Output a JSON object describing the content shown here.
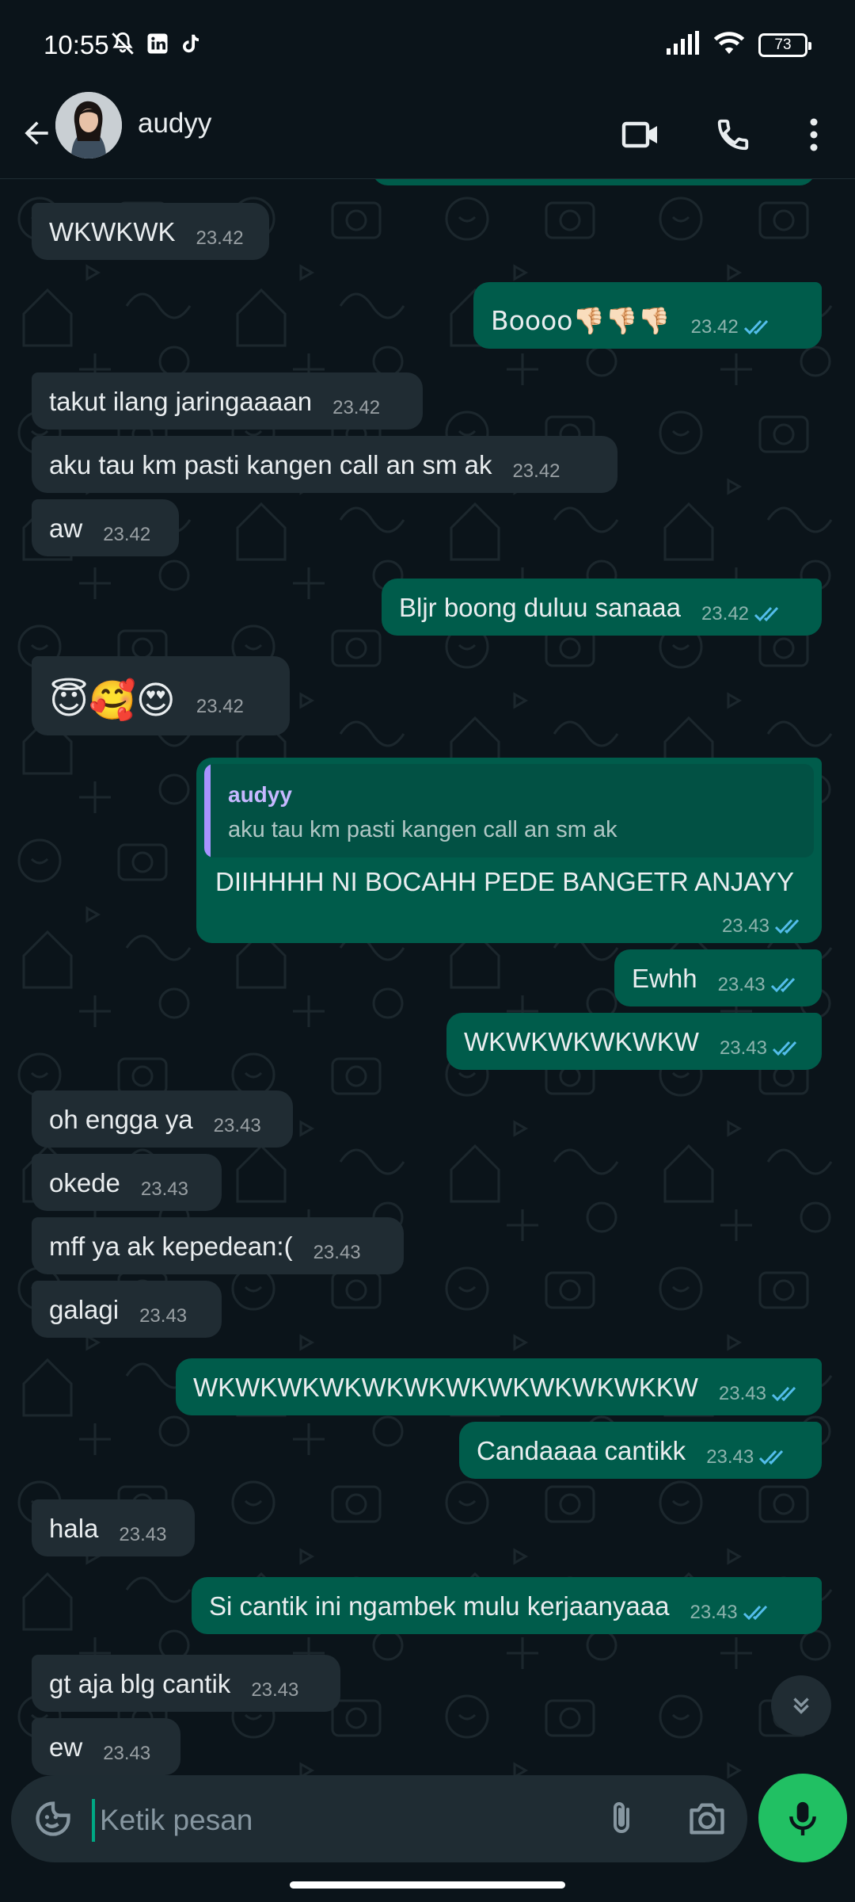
{
  "status_bar": {
    "time": "10:55",
    "battery": "73",
    "icons": [
      "mute-bell-icon",
      "linkedin-icon",
      "tiktok-icon",
      "signal-icon",
      "wifi-icon",
      "battery-icon"
    ]
  },
  "header": {
    "contact_name": "audyy",
    "icons": [
      "back-arrow-icon",
      "video-call-icon",
      "phone-icon",
      "more-vertical-icon"
    ]
  },
  "messages": [
    {
      "dir": "in",
      "text": "WKWKWK",
      "time": "23.42"
    },
    {
      "dir": "out",
      "text": "Boooo👎🏻👎🏻👎🏻",
      "time": "23.42",
      "read": true
    },
    {
      "dir": "in",
      "text": "takut ilang jaringaaaan",
      "time": "23.42"
    },
    {
      "dir": "in",
      "text": "aku tau km pasti kangen call an sm ak",
      "time": "23.42"
    },
    {
      "dir": "in",
      "text": "aw",
      "time": "23.42"
    },
    {
      "dir": "out",
      "text": "Bljr boong duluu sanaaa",
      "time": "23.42",
      "read": true
    },
    {
      "dir": "in",
      "text": "😇🥰😍",
      "time": "23.42"
    },
    {
      "dir": "out",
      "text": "DIIHHHH NI BOCAHH PEDE BANGETR ANJAYY",
      "time": "23.43",
      "read": true,
      "quote": {
        "name": "audyy",
        "text": "aku tau km pasti kangen call an sm ak"
      }
    },
    {
      "dir": "out",
      "text": "Ewhh",
      "time": "23.43",
      "read": true
    },
    {
      "dir": "out",
      "text": "WKWKWKWKWKW",
      "time": "23.43",
      "read": true
    },
    {
      "dir": "in",
      "text": "oh engga ya",
      "time": "23.43"
    },
    {
      "dir": "in",
      "text": "okede",
      "time": "23.43"
    },
    {
      "dir": "in",
      "text": "mff ya ak kepedean:(",
      "time": "23.43"
    },
    {
      "dir": "in",
      "text": "galagi",
      "time": "23.43"
    },
    {
      "dir": "out",
      "text": "WKWKWKWKWKWKWKWKWKWKWKKW",
      "time": "23.43",
      "read": true
    },
    {
      "dir": "out",
      "text": "Candaaaa cantikk",
      "time": "23.43",
      "read": true
    },
    {
      "dir": "in",
      "text": "hala",
      "time": "23.43"
    },
    {
      "dir": "out",
      "text": "Si cantik ini ngambek mulu kerjaanyaaa",
      "time": "23.43",
      "read": true
    },
    {
      "dir": "in",
      "text": "gt aja blg cantik",
      "time": "23.43"
    },
    {
      "dir": "in",
      "text": "ew",
      "time": "23.43"
    }
  ],
  "composer": {
    "placeholder": "Ketik pesan",
    "value": "",
    "icons": [
      "sticker-icon",
      "paperclip-icon",
      "camera-icon",
      "mic-icon"
    ]
  },
  "colors": {
    "background": "#0b141a",
    "incoming_bubble": "#202c33",
    "outgoing_bubble": "#005c4b",
    "accent": "#21c063",
    "read_ticks": "#53bdeb"
  }
}
